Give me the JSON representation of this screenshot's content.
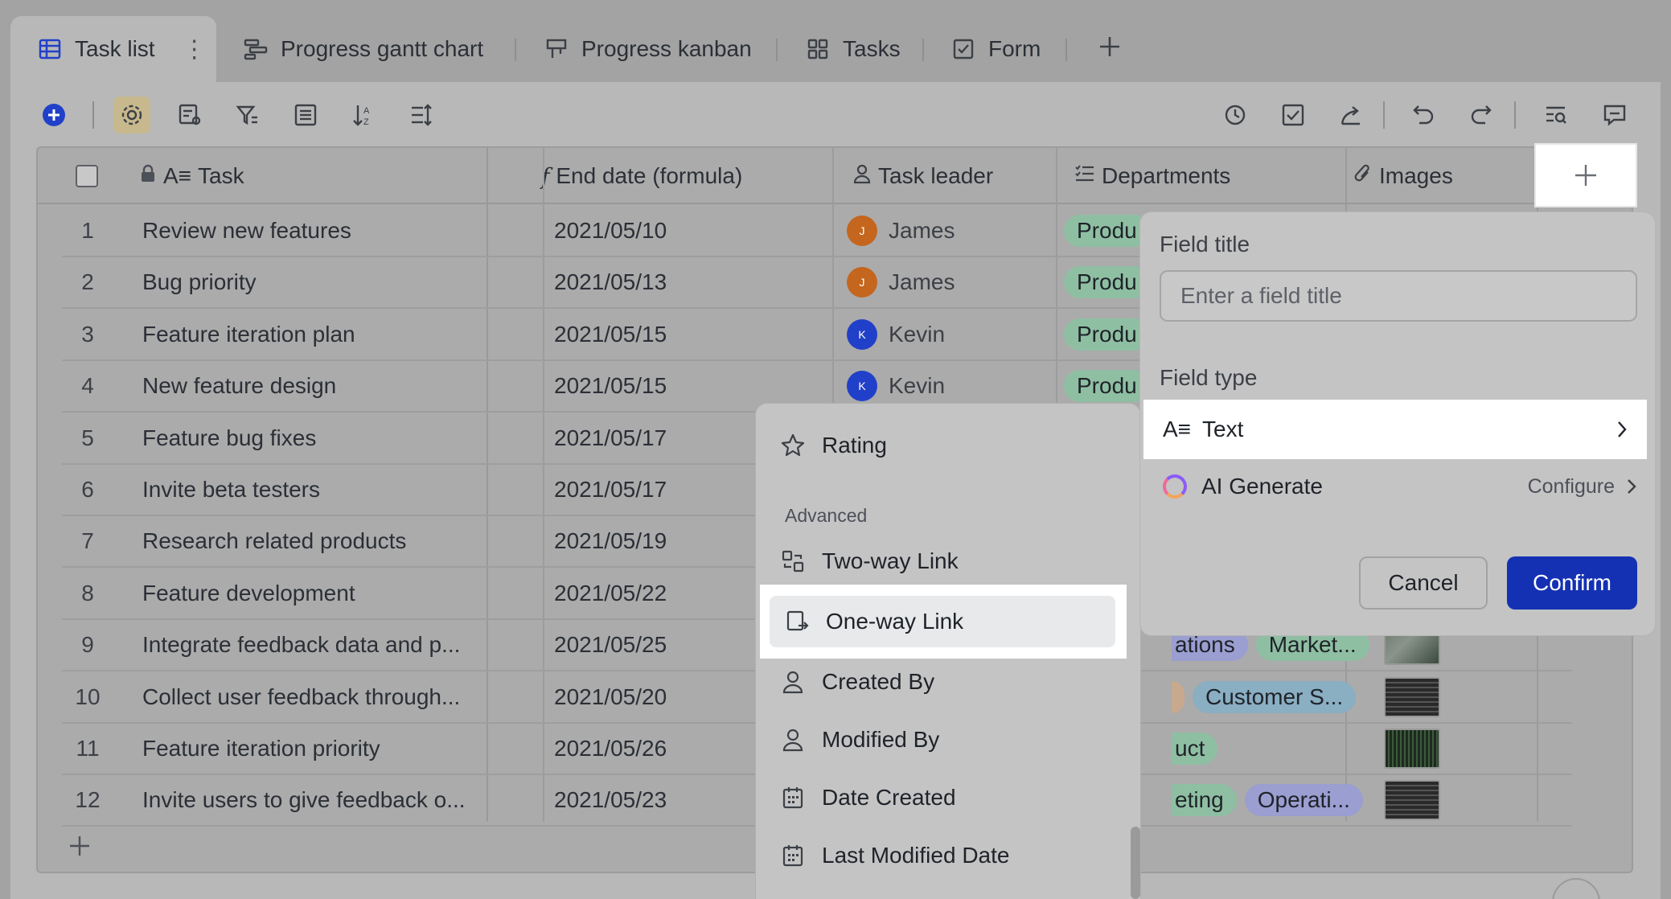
{
  "tabs": [
    {
      "label": "Task list",
      "icon": "table-icon",
      "active": true
    },
    {
      "label": "Progress gantt chart",
      "icon": "gantt-icon"
    },
    {
      "label": "Progress kanban",
      "icon": "kanban-icon"
    },
    {
      "label": "Tasks",
      "icon": "gallery-icon"
    },
    {
      "label": "Form",
      "icon": "form-icon"
    }
  ],
  "columns": {
    "task": "Task",
    "end_date": "End date (formula)",
    "leader": "Task leader",
    "departments": "Departments",
    "images": "Images"
  },
  "rows": [
    {
      "num": "1",
      "task": "Review new features",
      "date": "2021/05/10",
      "leader": "James",
      "initial": "J",
      "dept": "Produ"
    },
    {
      "num": "2",
      "task": "Bug priority",
      "date": "2021/05/13",
      "leader": "James",
      "initial": "J",
      "dept": "Produ"
    },
    {
      "num": "3",
      "task": "Feature iteration plan",
      "date": "2021/05/15",
      "leader": "Kevin",
      "initial": "K",
      "dept": "Produ"
    },
    {
      "num": "4",
      "task": "New feature design",
      "date": "2021/05/15",
      "leader": "Kevin",
      "initial": "K",
      "dept": "Produ"
    },
    {
      "num": "5",
      "task": "Feature bug fixes",
      "date": "2021/05/17"
    },
    {
      "num": "6",
      "task": "Invite beta testers",
      "date": "2021/05/17"
    },
    {
      "num": "7",
      "task": "Research related products",
      "date": "2021/05/19"
    },
    {
      "num": "8",
      "task": "Feature development",
      "date": "2021/05/22"
    },
    {
      "num": "9",
      "task": "Integrate feedback data and p...",
      "date": "2021/05/25",
      "tag1": "ations",
      "tag2": "Market..."
    },
    {
      "num": "10",
      "task": "Collect user feedback through...",
      "date": "2021/05/20",
      "tag2": "Customer S..."
    },
    {
      "num": "11",
      "task": "Feature iteration priority",
      "date": "2021/05/26",
      "tag1": "uct"
    },
    {
      "num": "12",
      "task": "Invite users to give feedback o...",
      "date": "2021/05/23",
      "tag1": "eting",
      "tag2": "Operati..."
    }
  ],
  "menu": {
    "rating": "Rating",
    "group_advanced": "Advanced",
    "two_way": "Two-way Link",
    "one_way": "One-way Link",
    "created_by": "Created By",
    "modified_by": "Modified By",
    "date_created": "Date Created",
    "last_modified": "Last Modified Date"
  },
  "panel": {
    "field_title_label": "Field title",
    "field_title_placeholder": "Enter a field title",
    "field_type_label": "Field type",
    "field_type_value": "Text",
    "ai_label": "AI Generate",
    "ai_configure": "Configure",
    "cancel": "Cancel",
    "confirm": "Confirm"
  },
  "colors": {
    "accent": "#1431b3",
    "avatar_james": "#c4661d",
    "avatar_kevin": "#2140c9",
    "tag_green": "#8fbfa3",
    "tag_blue": "#8aaec2",
    "tag_purple": "#9a9ed0"
  }
}
